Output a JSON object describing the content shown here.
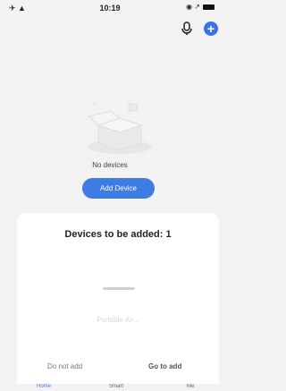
{
  "status_bar": {
    "left": "✈ ▲",
    "time": "10:19",
    "right": "◉ ↗"
  },
  "header": {
    "plus_label": "+"
  },
  "empty_state": {
    "message": "No devices",
    "add_button": "Add Device"
  },
  "tabbar": {
    "home": "Home",
    "smart": "Smart",
    "me": "Me"
  },
  "sheet": {
    "title": "Devices to be added: 1",
    "device_name": "Portable Air...",
    "cancel": "Do not add",
    "confirm": "Go to add"
  },
  "colors": {
    "accent": "#3e7be2"
  }
}
